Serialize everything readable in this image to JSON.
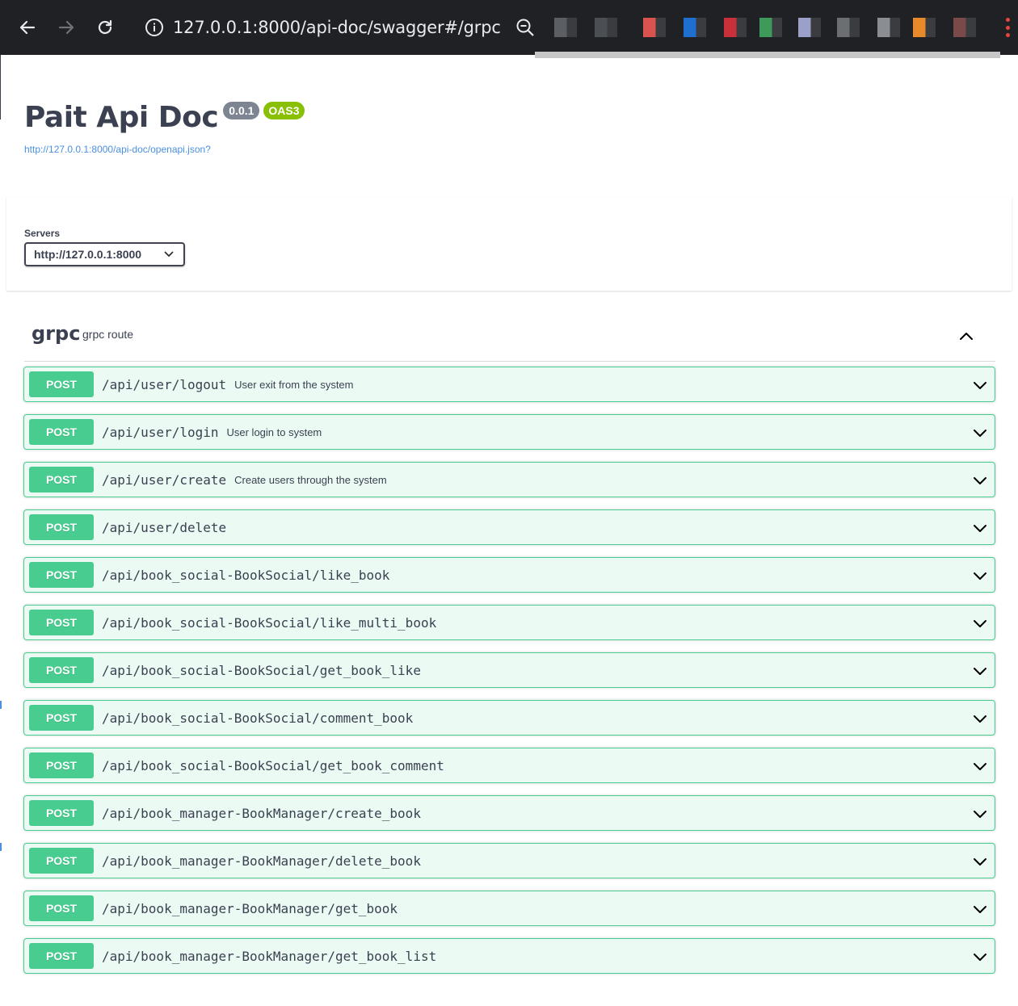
{
  "browser": {
    "url": "127.0.0.1:8000/api-doc/swagger#/grpc",
    "extensions": [
      {
        "name": "extension-1",
        "color": "#5b5e63"
      },
      {
        "name": "extension-2",
        "color": "#4b4e53"
      },
      {
        "name": "extension-3",
        "color": "#d9534f"
      },
      {
        "name": "extension-4",
        "color": "#1f6fd1"
      },
      {
        "name": "extension-5",
        "color": "#c9303a"
      },
      {
        "name": "extension-6",
        "color": "#3e9a5a"
      },
      {
        "name": "extension-7",
        "color": "#9aa0c8"
      },
      {
        "name": "extension-8",
        "color": "#6b6e73"
      },
      {
        "name": "extension-9",
        "color": "#8a8d92"
      },
      {
        "name": "extension-10",
        "color": "#e8892c"
      },
      {
        "name": "extension-11",
        "color": "#7a4a4a"
      }
    ]
  },
  "info": {
    "title": "Pait Api Doc",
    "version": "0.0.1",
    "oas_badge": "OAS3",
    "spec_url": "http://127.0.0.1:8000/api-doc/openapi.json?"
  },
  "servers": {
    "label": "Servers",
    "selected": "http://127.0.0.1:8000"
  },
  "tag": {
    "name": "grpc",
    "description": "grpc route"
  },
  "operations": [
    {
      "method": "POST",
      "path": "/api/user/logout",
      "summary": "User exit from the system"
    },
    {
      "method": "POST",
      "path": "/api/user/login",
      "summary": "User login to system"
    },
    {
      "method": "POST",
      "path": "/api/user/create",
      "summary": "Create users through the system"
    },
    {
      "method": "POST",
      "path": "/api/user/delete",
      "summary": ""
    },
    {
      "method": "POST",
      "path": "/api/book_social-BookSocial/like_book",
      "summary": ""
    },
    {
      "method": "POST",
      "path": "/api/book_social-BookSocial/like_multi_book",
      "summary": ""
    },
    {
      "method": "POST",
      "path": "/api/book_social-BookSocial/get_book_like",
      "summary": ""
    },
    {
      "method": "POST",
      "path": "/api/book_social-BookSocial/comment_book",
      "summary": ""
    },
    {
      "method": "POST",
      "path": "/api/book_social-BookSocial/get_book_comment",
      "summary": ""
    },
    {
      "method": "POST",
      "path": "/api/book_manager-BookManager/create_book",
      "summary": ""
    },
    {
      "method": "POST",
      "path": "/api/book_manager-BookManager/delete_book",
      "summary": ""
    },
    {
      "method": "POST",
      "path": "/api/book_manager-BookManager/get_book",
      "summary": ""
    },
    {
      "method": "POST",
      "path": "/api/book_manager-BookManager/get_book_list",
      "summary": ""
    }
  ],
  "colors": {
    "post": "#49cc90",
    "text": "#3b4151",
    "link": "#4990e2",
    "version_badge": "#7d8492",
    "oas_badge": "#89bf04"
  }
}
